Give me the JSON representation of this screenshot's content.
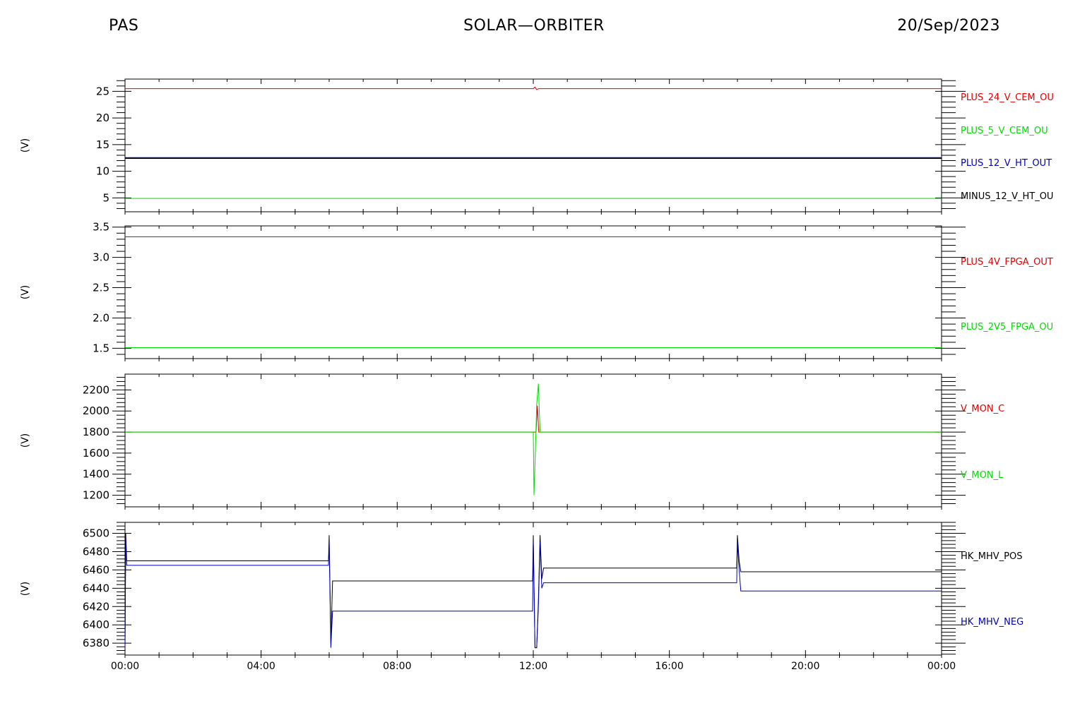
{
  "header": {
    "left": "PAS",
    "center": "SOLAR—ORBITER",
    "right": "20/Sep/2023"
  },
  "colors": {
    "red": "#e00000",
    "green": "#00dd00",
    "blue": "#0000bb",
    "black": "#000000"
  },
  "x_axis": {
    "range_hours": [
      0,
      24
    ],
    "tick_labels": [
      "00:00",
      "04:00",
      "08:00",
      "12:00",
      "16:00",
      "20:00",
      "00:00"
    ]
  },
  "chart_data": [
    {
      "type": "line",
      "ylabel": "(V)",
      "ylim": [
        2.4,
        27.3
      ],
      "yticks": [
        5,
        10,
        15,
        20,
        25
      ],
      "ytick_labels": [
        "5",
        "10",
        "15",
        "20",
        "25"
      ],
      "series": [
        {
          "name": "PLUS_24_V_CEM_OU",
          "color": "red",
          "x": [
            0,
            12.0,
            12.05,
            12.1,
            12.15,
            12.2,
            24
          ],
          "y": [
            25.5,
            25.5,
            25.8,
            25.3,
            25.5,
            25.5,
            25.5
          ]
        },
        {
          "name": "PLUS_5_V_CEM_OU",
          "color": "green",
          "x": [
            0,
            24
          ],
          "y": [
            4.9,
            4.9
          ]
        },
        {
          "name": "PLUS_12_V_HT_OUT",
          "color": "blue",
          "x": [
            0,
            24
          ],
          "y": [
            12.5,
            12.5
          ],
          "width": 2
        },
        {
          "name": "MINUS_12_V_HT_OU",
          "color": "black",
          "x": [
            0,
            24
          ],
          "y": [
            12.4,
            12.4
          ]
        }
      ]
    },
    {
      "type": "line",
      "ylabel": "(V)",
      "ylim": [
        1.33,
        3.52
      ],
      "yticks": [
        1.5,
        2.0,
        2.5,
        3.0,
        3.5
      ],
      "ytick_labels": [
        "1.5",
        "2.0",
        "2.5",
        "3.0",
        "3.5"
      ],
      "series": [
        {
          "name": "PLUS_4V_FPGA_OUT",
          "color": "red",
          "x": [
            0,
            24
          ],
          "y": [
            3.34,
            3.34
          ]
        },
        {
          "name": "PLUS_2V5_FPGA_OU",
          "color": "green",
          "x": [
            0,
            24
          ],
          "y": [
            1.51,
            1.51
          ]
        }
      ]
    },
    {
      "type": "line",
      "ylabel": "(V)",
      "ylim": [
        1090,
        2350
      ],
      "yticks": [
        1200,
        1400,
        1600,
        1800,
        2000,
        2200
      ],
      "ytick_labels": [
        "1200",
        "1400",
        "1600",
        "1800",
        "2000",
        "2200"
      ],
      "series": [
        {
          "name": "V_MON_C",
          "color": "red",
          "x": [
            0,
            12.08,
            12.12,
            12.16,
            24
          ],
          "y": [
            1800,
            1800,
            2050,
            1800,
            1800
          ]
        },
        {
          "name": "V_MON_L",
          "color": "green",
          "x": [
            0,
            12.0,
            12.02,
            12.06,
            12.1,
            12.15,
            12.2,
            24
          ],
          "y": [
            1800,
            1800,
            1200,
            1600,
            2060,
            2260,
            1800,
            1800
          ]
        }
      ]
    },
    {
      "type": "line",
      "ylabel": "(V)",
      "ylim": [
        6367,
        6512
      ],
      "yticks": [
        6380,
        6400,
        6420,
        6440,
        6460,
        6480,
        6500
      ],
      "ytick_labels": [
        "6380",
        "6400",
        "6420",
        "6440",
        "6460",
        "6480",
        "6500"
      ],
      "series": [
        {
          "name": "HK_MHV_POS",
          "color": "black",
          "x": [
            0,
            0.02,
            0.05,
            0.1,
            5.98,
            6.0,
            6.05,
            6.1,
            11.98,
            12.0,
            12.05,
            12.1,
            12.15,
            12.2,
            12.25,
            12.3,
            17.98,
            18.0,
            18.05,
            18.1,
            24
          ],
          "y": [
            6375,
            6500,
            6470,
            6470,
            6470,
            6498,
            6380,
            6448,
            6448,
            6498,
            6375,
            6375,
            6426,
            6498,
            6450,
            6462,
            6462,
            6498,
            6470,
            6458,
            6458
          ]
        },
        {
          "name": "HK_MHV_NEG",
          "color": "blue",
          "x": [
            0,
            0.02,
            0.05,
            0.1,
            5.98,
            6.0,
            6.05,
            6.1,
            11.98,
            12.0,
            12.05,
            12.1,
            12.15,
            12.2,
            12.25,
            12.3,
            17.98,
            18.0,
            18.05,
            18.1,
            24
          ],
          "y": [
            6375,
            6495,
            6465,
            6465,
            6465,
            6490,
            6375,
            6415,
            6415,
            6490,
            6375,
            6375,
            6420,
            6490,
            6440,
            6446,
            6446,
            6490,
            6460,
            6437,
            6437
          ]
        }
      ]
    }
  ]
}
